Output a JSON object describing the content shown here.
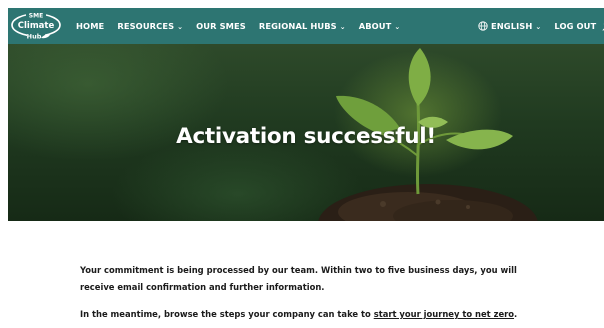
{
  "nav": {
    "logo_text": {
      "line1": "SME",
      "line2": "Climate",
      "line3": "Hub"
    },
    "items": [
      {
        "label": "HOME",
        "has_dropdown": false
      },
      {
        "label": "RESOURCES",
        "has_dropdown": true
      },
      {
        "label": "OUR SMES",
        "has_dropdown": false
      },
      {
        "label": "REGIONAL HUBS",
        "has_dropdown": true
      },
      {
        "label": "ABOUT",
        "has_dropdown": true
      }
    ],
    "language": "ENGLISH",
    "logout": "LOG OUT",
    "icons": {
      "language": "globe-icon",
      "dropdown": "chevron-down-icon",
      "user": "user-icon"
    },
    "colors": {
      "background": "#2d7572",
      "text": "#ffffff"
    }
  },
  "hero": {
    "title": "Activation successful!"
  },
  "content": {
    "paragraph1": "Your commitment is being processed by our team. Within two to five business days, you will receive email confirmation and further information.",
    "paragraph2_prefix": "In the meantime, browse the steps your company can take to ",
    "paragraph2_link": "start your journey to net zero",
    "paragraph2_suffix": "."
  }
}
